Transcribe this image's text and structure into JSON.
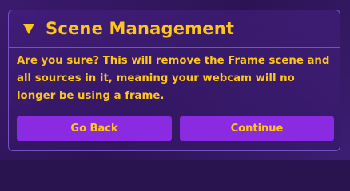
{
  "dialog": {
    "title": "Scene Management",
    "message": "Are you sure? This will remove the Frame scene and all sources in it, meaning your webcam will no longer be using a frame.",
    "buttons": {
      "back_label": "Go Back",
      "continue_label": "Continue"
    },
    "icons": {
      "collapse": "triangle-down-icon"
    }
  },
  "colors": {
    "accent_text": "#ffc61a",
    "button": "#8a2be2",
    "border": "#7650c4",
    "background": "#2c1454"
  }
}
